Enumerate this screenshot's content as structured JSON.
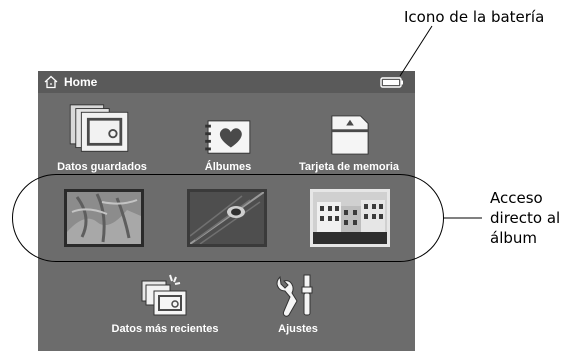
{
  "screen": {
    "title": "Home",
    "tiles_top": [
      {
        "label": "Datos guardados",
        "icon": "saved-data-icon"
      },
      {
        "label": "Álbumes",
        "icon": "album-heart-icon"
      },
      {
        "label": "Tarjeta de memoria",
        "icon": "memory-card-icon"
      }
    ],
    "tiles_bottom": [
      {
        "label": "Datos más recientes",
        "icon": "recent-data-icon"
      },
      {
        "label": "Ajustes",
        "icon": "settings-tools-icon"
      }
    ],
    "thumbnails": [
      "album-thumbnail-1",
      "album-thumbnail-2",
      "album-thumbnail-3"
    ]
  },
  "annotations": {
    "battery": "Icono de la batería",
    "album_shortcut": [
      "Acceso",
      "directo al",
      "álbum"
    ]
  },
  "colors": {
    "screen_bg": "#6c6c6c",
    "titlebar_bg": "#5a5a5a",
    "text": "#ffffff"
  }
}
